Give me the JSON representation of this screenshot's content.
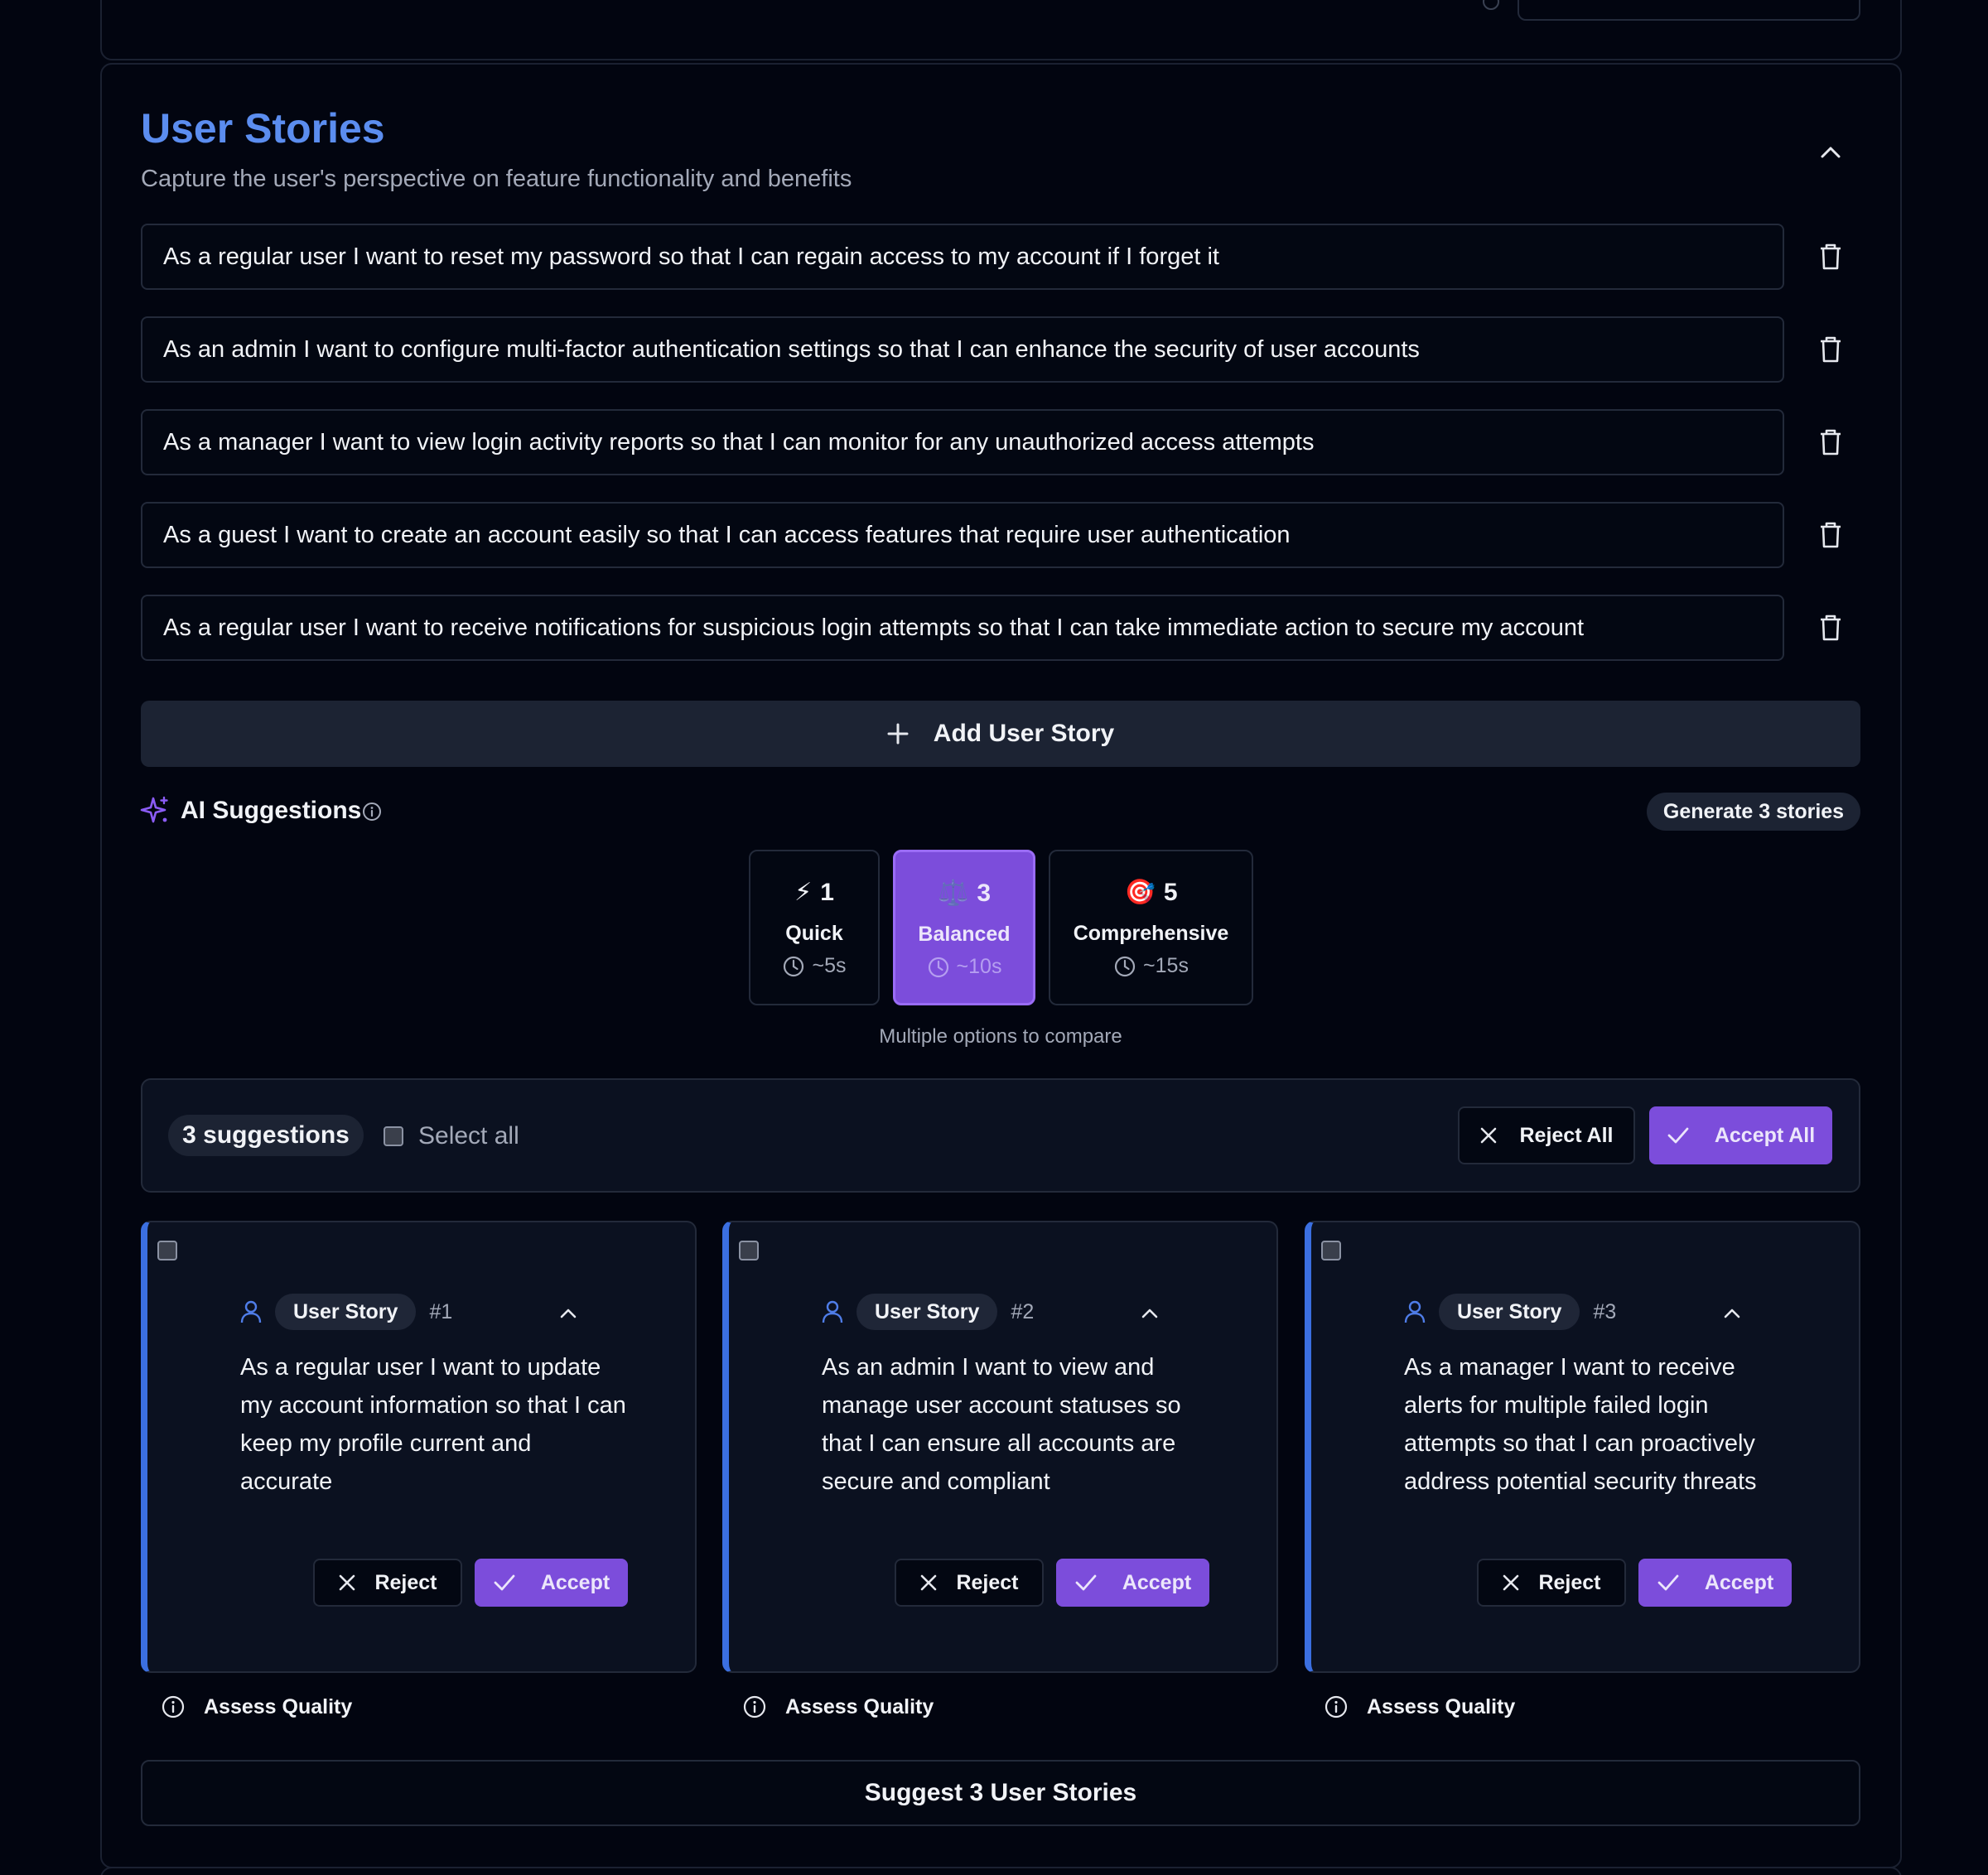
{
  "section": {
    "title": "User Stories",
    "subtitle": "Capture the user's perspective on feature functionality and benefits"
  },
  "stories": [
    "As a regular user I want to reset my password so that I can regain access to my account if I forget it",
    "As an admin I want to configure multi-factor authentication settings so that I can enhance the security of user accounts",
    "As a manager I want to view login activity reports so that I can monitor for any unauthorized access attempts",
    "As a guest I want to create an account easily so that I can access features that require user authentication",
    "As a regular user I want to receive notifications for suspicious login attempts so that I can take immediate action to secure my account"
  ],
  "add_story_label": "Add User Story",
  "ai": {
    "label": "AI Suggestions",
    "generate_label": "Generate 3 stories",
    "modes": [
      {
        "icon": "⚡",
        "count": "1",
        "name": "Quick",
        "time": "~5s",
        "selected": false
      },
      {
        "icon": "⚖️",
        "count": "3",
        "name": "Balanced",
        "time": "~10s",
        "selected": true
      },
      {
        "icon": "🎯",
        "count": "5",
        "name": "Comprehensive",
        "time": "~15s",
        "selected": false
      }
    ],
    "note": "Multiple options to compare"
  },
  "suggestions_bar": {
    "count_label": "3 suggestions",
    "select_all": "Select all",
    "reject_all": "Reject All",
    "accept_all": "Accept All"
  },
  "suggestions": [
    {
      "type": "User Story",
      "number": "#1",
      "text": "As a regular user I want to update my account information so that I can keep my profile current and accurate",
      "reject": "Reject",
      "accept": "Accept",
      "assess": "Assess Quality"
    },
    {
      "type": "User Story",
      "number": "#2",
      "text": "As an admin I want to view and manage user account statuses so that I can ensure all accounts are secure and compliant",
      "reject": "Reject",
      "accept": "Accept",
      "assess": "Assess Quality"
    },
    {
      "type": "User Story",
      "number": "#3",
      "text": "As a manager I want to receive alerts for multiple failed login attempts so that I can proactively address potential security threats",
      "reject": "Reject",
      "accept": "Accept",
      "assess": "Assess Quality"
    }
  ],
  "suggest_button": "Suggest 3 User Stories",
  "colors": {
    "background": "#020510",
    "title": "#5b8def",
    "accent_purple": "#7c4ddb",
    "card_border_accent": "#3b6fe0"
  }
}
